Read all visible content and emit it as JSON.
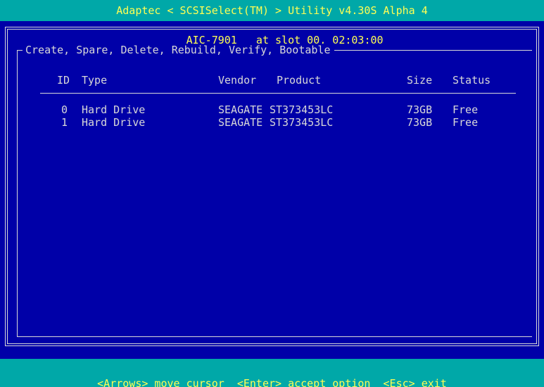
{
  "title_bar": {
    "text": "Adaptec < SCSISelect(TM) > Utility v4.30S Alpha 4"
  },
  "controller": {
    "caption": "AIC-7901   at slot 00, 02:03:00"
  },
  "menu": {
    "caption": "Create, Spare, Delete, Rebuild, Verify, Bootable"
  },
  "table": {
    "headers": {
      "id": "ID",
      "type": "Type",
      "vendor": "Vendor",
      "product": "Product",
      "size": "Size",
      "status": "Status"
    },
    "rows": [
      {
        "id": "0",
        "type": "Hard Drive",
        "vendor": "SEAGATE",
        "product": "ST373453LC",
        "size": "73GB",
        "status": "Free"
      },
      {
        "id": "1",
        "type": "Hard Drive",
        "vendor": "SEAGATE",
        "product": "ST373453LC",
        "size": "73GB",
        "status": "Free"
      }
    ]
  },
  "help_bar": {
    "text": "<Arrows> move cursor  <Enter> accept option  <Esc> exit"
  },
  "colors": {
    "background": "#0000a8",
    "bar": "#00a8a8",
    "highlight_text": "#ffff54",
    "text": "#d8d8d8"
  }
}
